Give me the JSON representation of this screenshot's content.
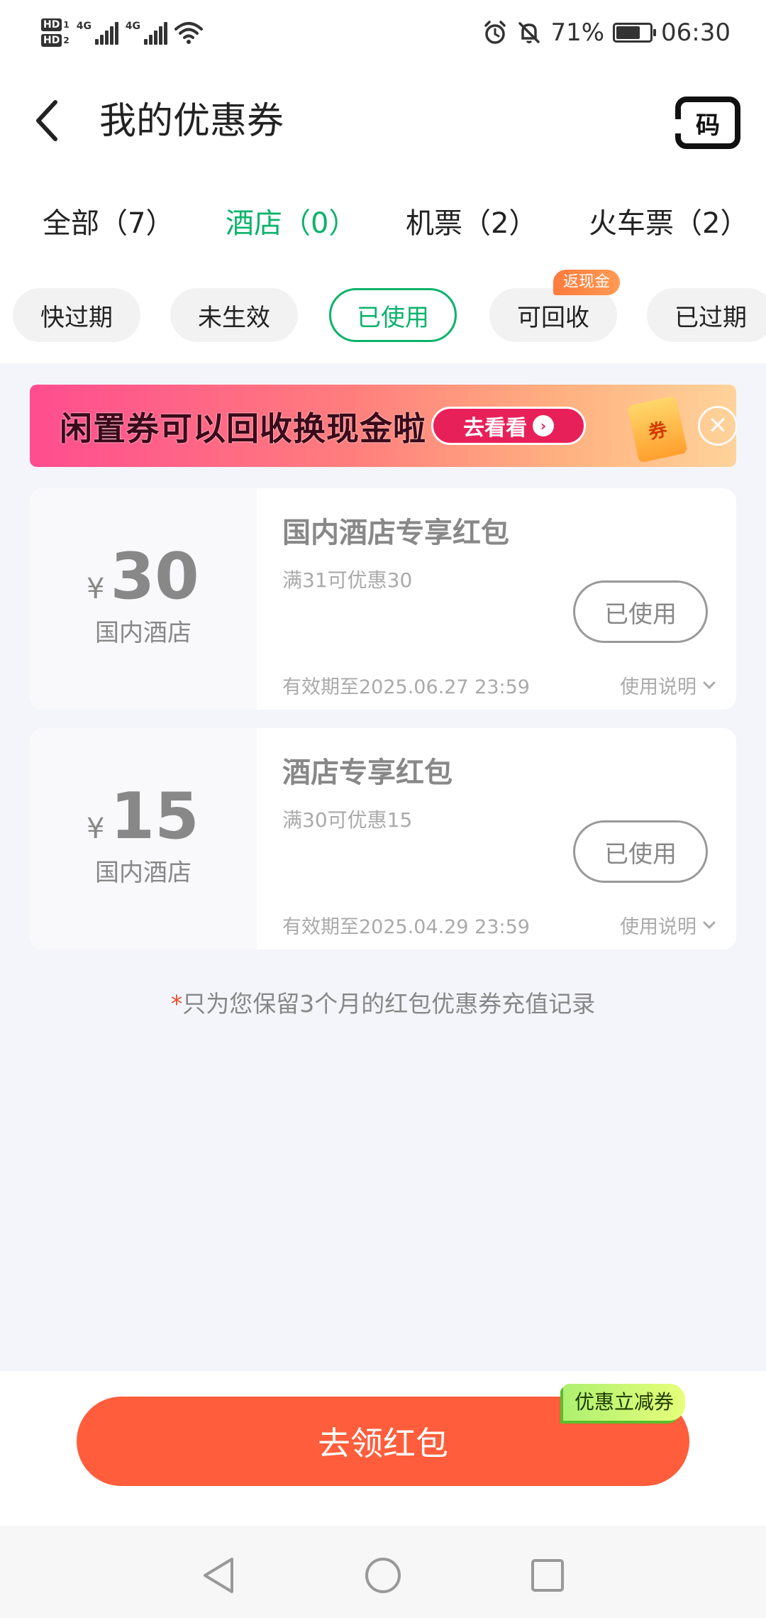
{
  "status_bar": {
    "hd1": "HD",
    "hd1_n": "1",
    "hd2": "HD",
    "hd2_n": "2",
    "net1": "4G",
    "net2": "4G",
    "battery_percent": "71%",
    "battery_level": 0.71,
    "time": "06:30"
  },
  "header": {
    "title": "我的优惠券",
    "code_label": "码"
  },
  "category_tabs": [
    {
      "label": "全部（7）"
    },
    {
      "label": "酒店（0）",
      "active": true
    },
    {
      "label": "机票（2）"
    },
    {
      "label": "火车票（2）"
    }
  ],
  "filters": [
    {
      "label": "快过期"
    },
    {
      "label": "未生效"
    },
    {
      "label": "已使用",
      "active": true
    },
    {
      "label": "可回收"
    },
    {
      "label": "已过期"
    }
  ],
  "filter_badge": "返现金",
  "banner": {
    "text": "闲置券可以回收换现金啦",
    "cta": "去看看",
    "ticket_label": "券"
  },
  "coupons": [
    {
      "currency": "¥",
      "amount": "30",
      "scope": "国内酒店",
      "title": "国内酒店专享红包",
      "condition": "满31可优惠30",
      "status_button": "已使用",
      "validity": "有效期至2025.06.27 23:59",
      "rules_link": "使用说明"
    },
    {
      "currency": "¥",
      "amount": "15",
      "scope": "国内酒店",
      "title": "酒店专享红包",
      "condition": "满30可优惠15",
      "status_button": "已使用",
      "validity": "有效期至2025.04.29 23:59",
      "rules_link": "使用说明"
    }
  ],
  "note": {
    "star": "*",
    "text": "只为您保留3个月的红包优惠券充值记录"
  },
  "bottom": {
    "cta": "去领红包",
    "tag": "优惠立减券"
  },
  "colors": {
    "accent": "#0bb36b",
    "cta": "#ff5d3b",
    "banner_start": "#ff4d8f",
    "banner_end": "#ffd39a"
  }
}
